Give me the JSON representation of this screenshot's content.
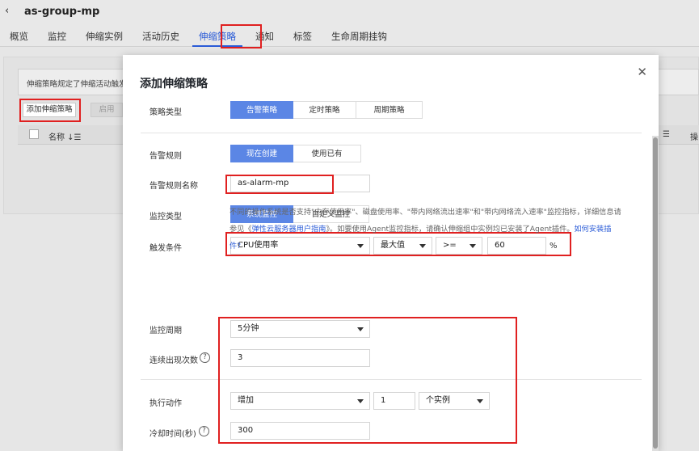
{
  "header": {
    "back_icon": "chevron-left",
    "title": "as-group-mp"
  },
  "tabs": [
    {
      "label": "概览"
    },
    {
      "label": "监控"
    },
    {
      "label": "伸缩实例"
    },
    {
      "label": "活动历史"
    },
    {
      "label": "伸缩策略",
      "active": true
    },
    {
      "label": "通知"
    },
    {
      "label": "标签"
    },
    {
      "label": "生命周期挂钩"
    }
  ],
  "background": {
    "note": "伸缩策略规定了伸缩活动触发",
    "add_button": "添加伸缩策略",
    "enable_button": "启用",
    "table": {
      "col_name": "名称 ↓☰",
      "col_right": "☰",
      "col_right2": "操"
    }
  },
  "modal": {
    "title": "添加伸缩策略",
    "close_icon": "close",
    "policy_type": {
      "label": "策略类型",
      "options": [
        "告警策略",
        "定时策略",
        "周期策略"
      ],
      "selected": "告警策略"
    },
    "alarm_rule": {
      "label": "告警规则",
      "options": [
        "现在创建",
        "使用已有"
      ],
      "selected": "现在创建"
    },
    "alarm_rule_name": {
      "label": "告警规则名称",
      "value": "as-alarm-mp"
    },
    "monitor_type": {
      "label": "监控类型",
      "options": [
        "系统监控",
        "自定义监控"
      ],
      "selected": "系统监控"
    },
    "trigger": {
      "label": "触发条件",
      "metric": "CPU使用率",
      "aggregation": "最大值",
      "operator": ">=",
      "threshold": "60",
      "unit": "%"
    },
    "help": {
      "line1": "不同的操作系统是否支持\"内存使用率\"、磁盘使用率、\"带内网络流出速率\"和\"带内网络流入速率\"监控指标，详细信息请",
      "line2_pre": "参见《",
      "line2_link": "弹性云服务器用户指南",
      "line2_mid": "》。如要使用Agent监控指标，请确认伸缩组中实例均已安装了Agent插件。",
      "line2_link2": "如何安装插",
      "line3": "件?"
    },
    "period": {
      "label": "监控周期",
      "value": "5分钟"
    },
    "occurrences": {
      "label": "连续出现次数",
      "value": "3"
    },
    "action": {
      "label": "执行动作",
      "operation": "增加",
      "count": "1",
      "unit": "个实例"
    },
    "cooldown": {
      "label": "冷却时间(秒)",
      "value": "300"
    }
  },
  "colors": {
    "accent": "#5b86e5",
    "highlight": "#e02020",
    "link": "#2a5bd7"
  }
}
